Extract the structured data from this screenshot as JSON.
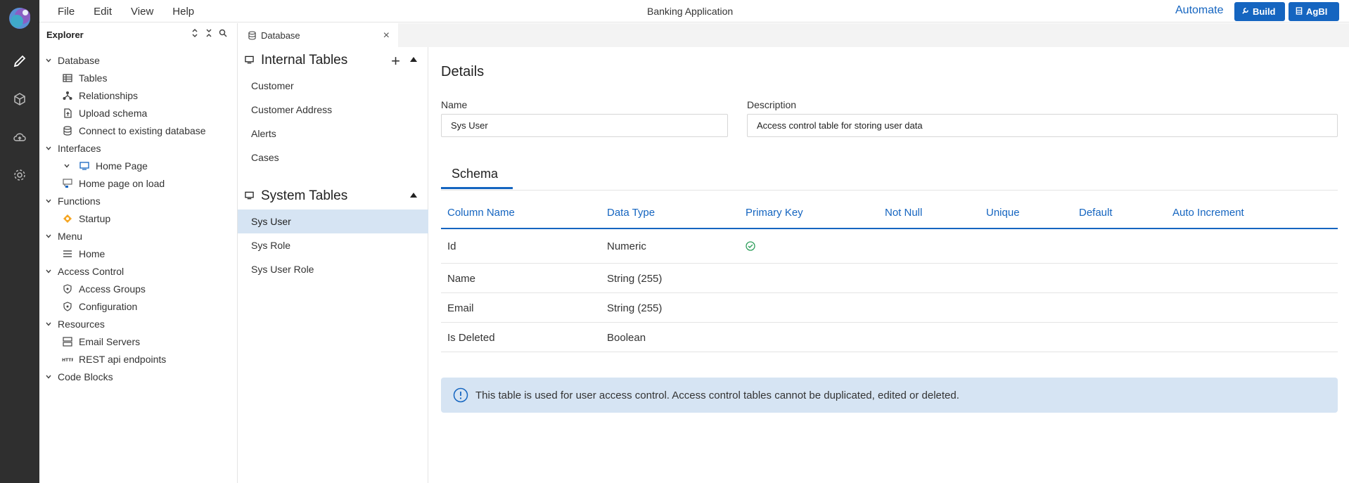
{
  "app": {
    "title": "Banking Application",
    "menu": [
      "File",
      "Edit",
      "View",
      "Help"
    ],
    "automate_label": "Automate",
    "build_label": "Build",
    "agbi_label": "AgBI",
    "accent": "#1565c0"
  },
  "explorer": {
    "title": "Explorer",
    "tree": [
      {
        "label": "Database",
        "level": 0,
        "icon": "chevron-down-icon"
      },
      {
        "label": "Tables",
        "level": 1,
        "icon": "table-icon"
      },
      {
        "label": "Relationships",
        "level": 1,
        "icon": "relationship-icon"
      },
      {
        "label": "Upload schema",
        "level": 1,
        "icon": "upload-file-icon"
      },
      {
        "label": "Connect to existing database",
        "level": 1,
        "icon": "database-icon"
      },
      {
        "label": "Interfaces",
        "level": 0,
        "icon": "chevron-down-icon"
      },
      {
        "label": "Home Page",
        "level": 2,
        "icon": "monitor-icon"
      },
      {
        "label": "Home page on load",
        "level": 1,
        "icon": "workflow-icon"
      },
      {
        "label": "Functions",
        "level": 0,
        "icon": "chevron-down-icon"
      },
      {
        "label": "Startup",
        "level": 1,
        "icon": "startup-icon"
      },
      {
        "label": "Menu",
        "level": 0,
        "icon": "chevron-down-icon"
      },
      {
        "label": "Home",
        "level": 1,
        "icon": "menu-lines-icon"
      },
      {
        "label": "Access Control",
        "level": 0,
        "icon": "chevron-down-icon"
      },
      {
        "label": "Access Groups",
        "level": 1,
        "icon": "shield-icon"
      },
      {
        "label": "Configuration",
        "level": 1,
        "icon": "shield-icon"
      },
      {
        "label": "Resources",
        "level": 0,
        "icon": "chevron-down-icon"
      },
      {
        "label": "Email Servers",
        "level": 1,
        "icon": "server-icon"
      },
      {
        "label": "REST api endpoints",
        "level": 1,
        "icon": "http-icon"
      },
      {
        "label": "Code Blocks",
        "level": 0,
        "icon": "chevron-down-icon"
      }
    ]
  },
  "tab": {
    "label": "Database"
  },
  "tables": {
    "internal_title": "Internal Tables",
    "internal": [
      "Customer",
      "Customer Address",
      "Alerts",
      "Cases"
    ],
    "system_title": "System Tables",
    "system": [
      "Sys User",
      "Sys Role",
      "Sys User Role"
    ],
    "selected": "Sys User"
  },
  "details": {
    "title": "Details",
    "name_label": "Name",
    "name_value": "Sys User",
    "description_label": "Description",
    "description_value": "Access control table for storing user data",
    "schema_tab": "Schema",
    "columns": [
      "Column Name",
      "Data Type",
      "Primary Key",
      "Not Null",
      "Unique",
      "Default",
      "Auto Increment"
    ],
    "rows": [
      {
        "name": "Id",
        "type": "Numeric",
        "primary_key": true
      },
      {
        "name": "Name",
        "type": "String (255)",
        "primary_key": false
      },
      {
        "name": "Email",
        "type": "String (255)",
        "primary_key": false
      },
      {
        "name": "Is Deleted",
        "type": "Boolean",
        "primary_key": false
      }
    ],
    "notice": "This table is used for user access control. Access control tables cannot be duplicated, edited or deleted."
  }
}
